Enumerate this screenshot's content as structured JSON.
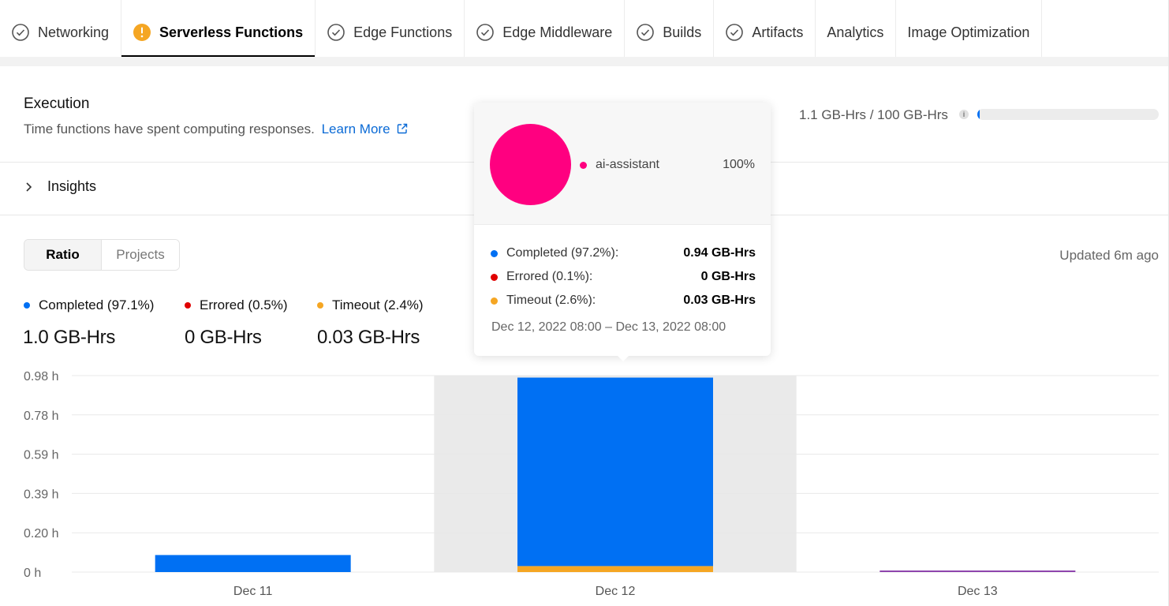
{
  "tabs": [
    {
      "label": "Networking",
      "icon": "check-circle-icon",
      "active": false
    },
    {
      "label": "Serverless Functions",
      "icon": "warning-circle-icon",
      "active": true
    },
    {
      "label": "Edge Functions",
      "icon": "check-circle-icon",
      "active": false
    },
    {
      "label": "Edge Middleware",
      "icon": "check-circle-icon",
      "active": false
    },
    {
      "label": "Builds",
      "icon": "check-circle-icon",
      "active": false
    },
    {
      "label": "Artifacts",
      "icon": "check-circle-icon",
      "active": false
    },
    {
      "label": "Analytics",
      "icon": "",
      "active": false
    },
    {
      "label": "Image Optimization",
      "icon": "",
      "active": false
    }
  ],
  "execution": {
    "title": "Execution",
    "description": "Time functions have spent computing responses.",
    "learn_more": "Learn More",
    "usage_text": "1.1 GB-Hrs / 100 GB-Hrs",
    "usage_fraction": 0.011
  },
  "insights": {
    "label": "Insights"
  },
  "view_toggle": {
    "ratio": "Ratio",
    "projects": "Projects",
    "selected": "Ratio"
  },
  "updated": "Updated 6m ago",
  "legend": [
    {
      "label": "Completed (97.1%)",
      "value": "1.0 GB-Hrs",
      "color": "#0070f3"
    },
    {
      "label": "Errored (0.5%)",
      "value": "0 GB-Hrs",
      "color": "#e00000"
    },
    {
      "label": "Timeout (2.4%)",
      "value": "0.03 GB-Hrs",
      "color": "#f5a623"
    }
  ],
  "colors": {
    "completed": "#0070f3",
    "errored": "#e00000",
    "timeout": "#f5a623",
    "project": "#ff0080",
    "other": "#8e44ad",
    "highlight": "#eaeaea",
    "grid": "#e8e8e8"
  },
  "chart_data": {
    "type": "bar",
    "stacked": true,
    "categories": [
      "Dec 11",
      "Dec 12",
      "Dec 13"
    ],
    "y_ticks": [
      "0 h",
      "0.20 h",
      "0.39 h",
      "0.59 h",
      "0.78 h",
      "0.98 h"
    ],
    "ylim": [
      0,
      0.98
    ],
    "series": [
      {
        "name": "Completed",
        "values": [
          0.085,
          0.94,
          0.0
        ]
      },
      {
        "name": "Errored",
        "values": [
          0.0,
          0.0,
          0.0
        ]
      },
      {
        "name": "Timeout",
        "values": [
          0.0,
          0.03,
          0.0
        ]
      }
    ],
    "other_values": [
      0.0,
      0.0,
      0.005
    ],
    "highlighted_category": "Dec 12",
    "grid": true
  },
  "tooltip": {
    "project_name": "ai-assistant",
    "project_pct": "100%",
    "rows": [
      {
        "label": "Completed (97.2%):",
        "value": "0.94 GB-Hrs",
        "color": "#0070f3"
      },
      {
        "label": "Errored (0.1%):",
        "value": "0 GB-Hrs",
        "color": "#e00000"
      },
      {
        "label": "Timeout (2.6%):",
        "value": "0.03 GB-Hrs",
        "color": "#f5a623"
      }
    ],
    "date_range": "Dec 12, 2022 08:00 – Dec 13, 2022 08:00"
  }
}
